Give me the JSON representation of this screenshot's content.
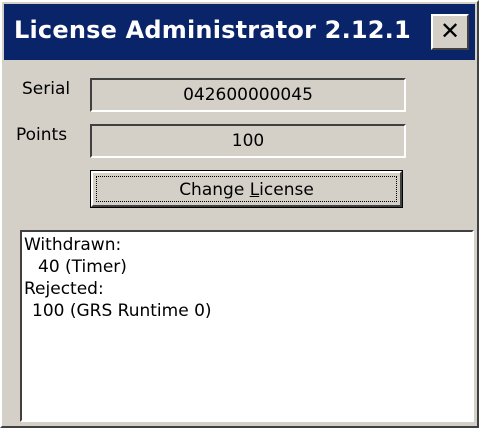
{
  "window": {
    "title": "License Administrator 2.12.1",
    "close_glyph": "✕"
  },
  "serial": {
    "label": "Serial",
    "value": "042600000045"
  },
  "points": {
    "label": "Points",
    "value": "100"
  },
  "change_license_button": {
    "label_before": "Change ",
    "label_mnemonic": "L",
    "label_after": "icense"
  },
  "log": {
    "lines": [
      "Withdrawn:",
      "40 (Timer)",
      "Rejected:",
      "100 (GRS Runtime 0)"
    ]
  },
  "colors": {
    "titlebar": "#0a246a",
    "face": "#d4d0c8",
    "window_bg": "#ffffff"
  }
}
